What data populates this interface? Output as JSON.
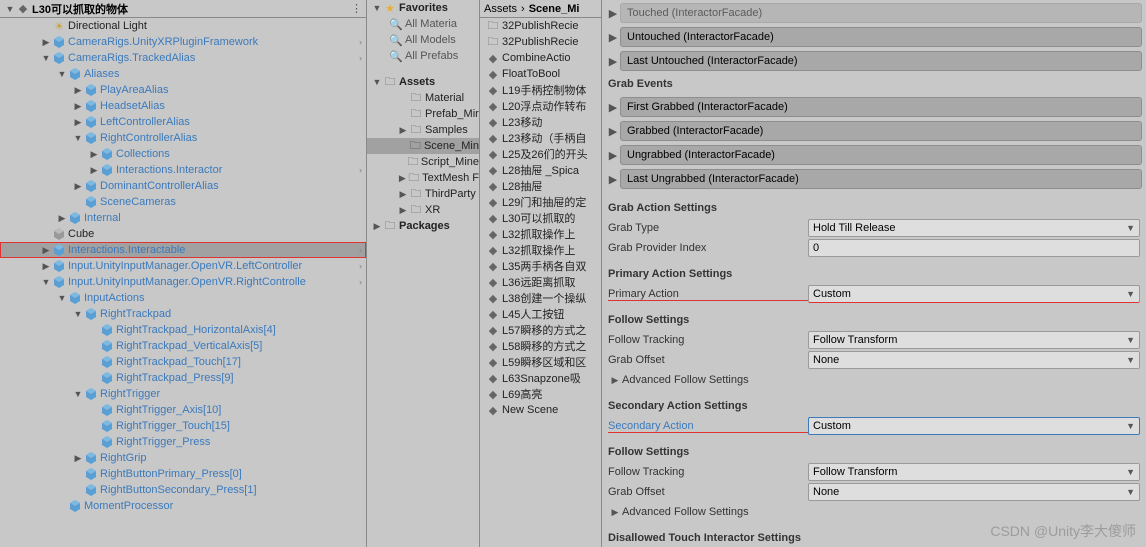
{
  "hierarchy": {
    "title": "L30可以抓取的物体",
    "items": [
      {
        "pad": 40,
        "fold": "",
        "icon": "light",
        "label": "Directional Light",
        "cls": ""
      },
      {
        "pad": 40,
        "fold": "▶",
        "icon": "cube",
        "label": "CameraRigs.UnityXRPluginFramework",
        "cls": "blue",
        "chev": true
      },
      {
        "pad": 40,
        "fold": "▼",
        "icon": "cube",
        "label": "CameraRigs.TrackedAlias",
        "cls": "blue",
        "chev": true
      },
      {
        "pad": 56,
        "fold": "▼",
        "icon": "cube",
        "label": "Aliases",
        "cls": "blue"
      },
      {
        "pad": 72,
        "fold": "▶",
        "icon": "cube",
        "label": "PlayAreaAlias",
        "cls": "blue"
      },
      {
        "pad": 72,
        "fold": "▶",
        "icon": "cube",
        "label": "HeadsetAlias",
        "cls": "blue"
      },
      {
        "pad": 72,
        "fold": "▶",
        "icon": "cube",
        "label": "LeftControllerAlias",
        "cls": "blue"
      },
      {
        "pad": 72,
        "fold": "▼",
        "icon": "cube",
        "label": "RightControllerAlias",
        "cls": "blue"
      },
      {
        "pad": 88,
        "fold": "▶",
        "icon": "cube",
        "label": "Collections",
        "cls": "blue"
      },
      {
        "pad": 88,
        "fold": "▶",
        "icon": "cube",
        "label": "Interactions.Interactor",
        "cls": "blue",
        "chev": true
      },
      {
        "pad": 72,
        "fold": "▶",
        "icon": "cube",
        "label": "DominantControllerAlias",
        "cls": "blue"
      },
      {
        "pad": 72,
        "fold": "",
        "icon": "cube",
        "label": "SceneCameras",
        "cls": "blue"
      },
      {
        "pad": 56,
        "fold": "▶",
        "icon": "cube",
        "label": "Internal",
        "cls": "blue"
      },
      {
        "pad": 40,
        "fold": "",
        "icon": "cube-gray",
        "label": "Cube",
        "cls": ""
      },
      {
        "pad": 40,
        "fold": "▶",
        "icon": "cube",
        "label": "Interactions.Interactable",
        "cls": "blue",
        "sel": true,
        "hl": true,
        "chev": true
      },
      {
        "pad": 40,
        "fold": "▶",
        "icon": "cube",
        "label": "Input.UnityInputManager.OpenVR.LeftController",
        "cls": "blue",
        "chev": true
      },
      {
        "pad": 40,
        "fold": "▼",
        "icon": "cube",
        "label": "Input.UnityInputManager.OpenVR.RightControlle",
        "cls": "blue",
        "chev": true
      },
      {
        "pad": 56,
        "fold": "▼",
        "icon": "cube",
        "label": "InputActions",
        "cls": "blue"
      },
      {
        "pad": 72,
        "fold": "▼",
        "icon": "cube",
        "label": "RightTrackpad",
        "cls": "blue"
      },
      {
        "pad": 88,
        "fold": "",
        "icon": "cube",
        "label": "RightTrackpad_HorizontalAxis[4]",
        "cls": "blue"
      },
      {
        "pad": 88,
        "fold": "",
        "icon": "cube",
        "label": "RightTrackpad_VerticalAxis[5]",
        "cls": "blue"
      },
      {
        "pad": 88,
        "fold": "",
        "icon": "cube",
        "label": "RightTrackpad_Touch[17]",
        "cls": "blue"
      },
      {
        "pad": 88,
        "fold": "",
        "icon": "cube",
        "label": "RightTrackpad_Press[9]",
        "cls": "blue"
      },
      {
        "pad": 72,
        "fold": "▼",
        "icon": "cube",
        "label": "RightTrigger",
        "cls": "blue"
      },
      {
        "pad": 88,
        "fold": "",
        "icon": "cube",
        "label": "RightTrigger_Axis[10]",
        "cls": "blue"
      },
      {
        "pad": 88,
        "fold": "",
        "icon": "cube",
        "label": "RightTrigger_Touch[15]",
        "cls": "blue"
      },
      {
        "pad": 88,
        "fold": "",
        "icon": "cube",
        "label": "RightTrigger_Press",
        "cls": "blue"
      },
      {
        "pad": 72,
        "fold": "▶",
        "icon": "cube",
        "label": "RightGrip",
        "cls": "blue"
      },
      {
        "pad": 72,
        "fold": "",
        "icon": "cube",
        "label": "RightButtonPrimary_Press[0]",
        "cls": "blue"
      },
      {
        "pad": 72,
        "fold": "",
        "icon": "cube",
        "label": "RightButtonSecondary_Press[1]",
        "cls": "blue"
      },
      {
        "pad": 56,
        "fold": "",
        "icon": "cube",
        "label": "MomentProcessor",
        "cls": "blue"
      }
    ]
  },
  "project1": {
    "favLabel": "Favorites",
    "favs": [
      "All Materia",
      "All Models",
      "All Prefabs"
    ],
    "assetsLabel": "Assets",
    "assets": [
      {
        "pad": 30,
        "fold": "",
        "icon": "folder",
        "label": "Material"
      },
      {
        "pad": 30,
        "fold": "",
        "icon": "folder",
        "label": "Prefab_Mir"
      },
      {
        "pad": 30,
        "fold": "▶",
        "icon": "folder",
        "label": "Samples"
      },
      {
        "pad": 30,
        "fold": "",
        "icon": "folder-d",
        "label": "Scene_Min",
        "sel": true
      },
      {
        "pad": 30,
        "fold": "",
        "icon": "folder",
        "label": "Script_Mine"
      },
      {
        "pad": 30,
        "fold": "▶",
        "icon": "folder",
        "label": "TextMesh F"
      },
      {
        "pad": 30,
        "fold": "▶",
        "icon": "folder",
        "label": "ThirdParty"
      },
      {
        "pad": 30,
        "fold": "▶",
        "icon": "folder",
        "label": "XR"
      }
    ],
    "packagesLabel": "Packages"
  },
  "project2": {
    "crumb1": "Assets",
    "crumb2": "Scene_Mi",
    "items": [
      {
        "icon": "folder",
        "label": "32PublishRecie"
      },
      {
        "icon": "folder",
        "label": "32PublishRecie"
      },
      {
        "icon": "unity",
        "label": "CombineActio"
      },
      {
        "icon": "unity",
        "label": "FloatToBool"
      },
      {
        "icon": "unity",
        "label": "L19手柄控制物体"
      },
      {
        "icon": "unity",
        "label": "L20浮点动作转布"
      },
      {
        "icon": "unity",
        "label": "L23移动"
      },
      {
        "icon": "unity",
        "label": "L23移动（手柄自"
      },
      {
        "icon": "unity",
        "label": "L25及26们的开头"
      },
      {
        "icon": "unity",
        "label": "L28抽屉 _Spica"
      },
      {
        "icon": "unity",
        "label": "L28抽屉"
      },
      {
        "icon": "unity",
        "label": "L29门和抽屉的定"
      },
      {
        "icon": "unity",
        "label": "L30可以抓取的"
      },
      {
        "icon": "unity",
        "label": "L32抓取操作上"
      },
      {
        "icon": "unity",
        "label": "L32抓取操作上"
      },
      {
        "icon": "unity",
        "label": "L35两手柄各自双"
      },
      {
        "icon": "unity",
        "label": "L36远距离抓取"
      },
      {
        "icon": "unity",
        "label": "L38创建一个操纵"
      },
      {
        "icon": "unity",
        "label": "L45人工按钮"
      },
      {
        "icon": "unity",
        "label": "L57瞬移的方式之"
      },
      {
        "icon": "unity",
        "label": "L58瞬移的方式之"
      },
      {
        "icon": "unity",
        "label": "L59瞬移区域和区"
      },
      {
        "icon": "unity",
        "label": "L63Snapzone吸"
      },
      {
        "icon": "unity",
        "label": "L69高亮"
      },
      {
        "icon": "unity",
        "label": "New Scene"
      }
    ]
  },
  "inspector": {
    "events1": [
      "Touched (InteractorFacade)",
      "Untouched (InteractorFacade)",
      "Last Untouched (InteractorFacade)"
    ],
    "grabEventsLabel": "Grab Events",
    "events2": [
      "First Grabbed (InteractorFacade)",
      "Grabbed (InteractorFacade)",
      "Ungrabbed (InteractorFacade)",
      "Last Ungrabbed (InteractorFacade)"
    ],
    "sections": {
      "grabActionSettings": "Grab Action Settings",
      "grabType": "Grab Type",
      "grabTypeVal": "Hold Till Release",
      "grabProviderIndex": "Grab Provider Index",
      "grabProviderIndexVal": "0",
      "primaryActionSettings": "Primary Action Settings",
      "primaryAction": "Primary Action",
      "primaryActionVal": "Custom",
      "followSettings": "Follow Settings",
      "followTracking": "Follow Tracking",
      "followTrackingVal": "Follow Transform",
      "grabOffset": "Grab Offset",
      "grabOffsetVal": "None",
      "advancedFollow": "Advanced Follow Settings",
      "secondaryActionSettings": "Secondary Action Settings",
      "secondaryAction": "Secondary Action",
      "secondaryActionVal": "Custom",
      "followSettings2": "Follow Settings",
      "followTracking2": "Follow Tracking",
      "followTrackingVal2": "Follow Transform",
      "grabOffset2": "Grab Offset",
      "grabOffsetVal2": "None",
      "advancedFollow2": "Advanced Follow Settings",
      "disallowed": "Disallowed Touch Interactor Settings"
    }
  },
  "watermark": "CSDN @Unity李大傻师"
}
